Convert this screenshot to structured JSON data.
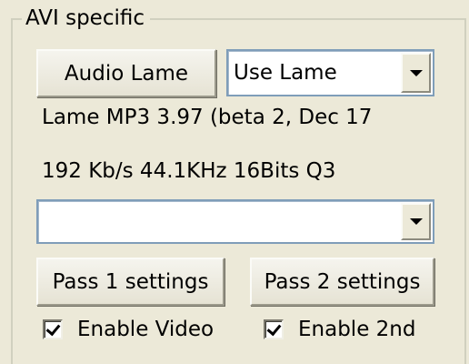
{
  "group": {
    "title": "AVI specific"
  },
  "audio": {
    "button_label": "Audio Lame",
    "combo_value": "Use Lame",
    "combo_arrow_icon": "chevron-down-icon"
  },
  "info": {
    "version_text": "Lame MP3 3.97 (beta 2, Dec 17",
    "format_text": "192 Kb/s 44.1KHz 16Bits Q3"
  },
  "second_combo": {
    "value": "",
    "arrow_icon": "chevron-down-icon"
  },
  "pass_buttons": {
    "pass1_label": "Pass 1 settings",
    "pass2_label": "Pass 2 settings"
  },
  "checkboxes": {
    "enable_video": {
      "label": "Enable Video",
      "checked": true
    },
    "enable_2nd": {
      "label": "Enable 2nd",
      "checked": true
    }
  },
  "colors": {
    "background": "#ece9d8",
    "combo_border": "#7f9db9",
    "group_border": "#d0d0bf"
  }
}
